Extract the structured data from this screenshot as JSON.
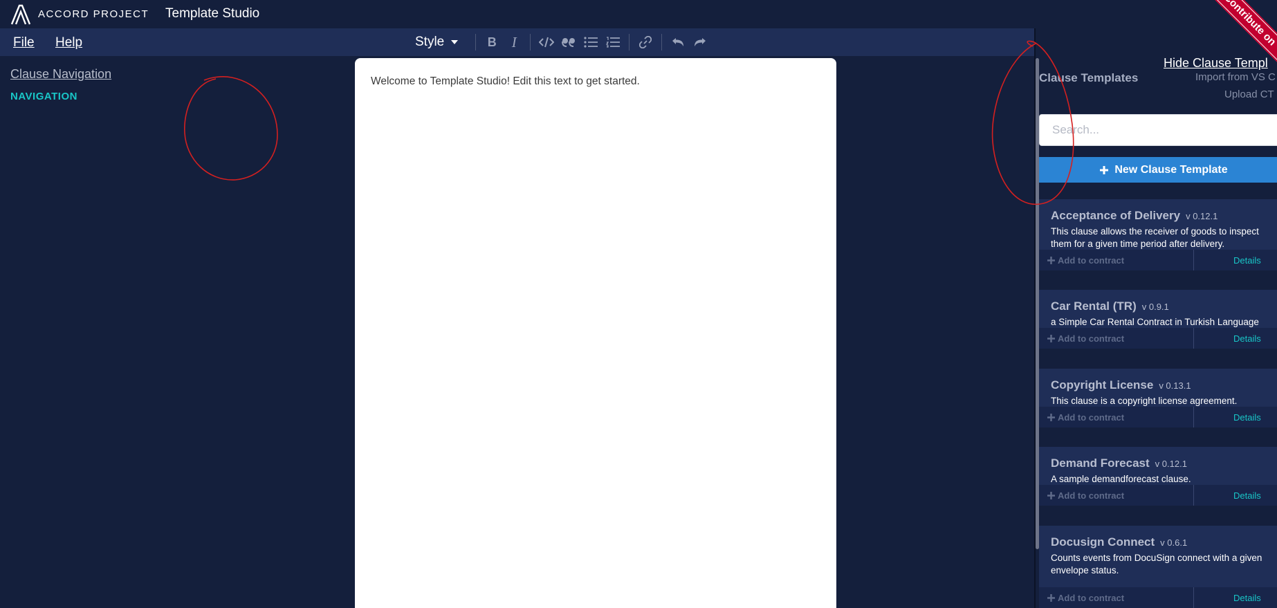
{
  "header": {
    "brand": "ACCORD PROJECT",
    "app_title": "Template Studio",
    "ribbon": "Contribute on"
  },
  "menu": {
    "file": "File",
    "help": "Help"
  },
  "toolbar": {
    "style_label": "Style",
    "buttons": [
      "bold-icon",
      "italic-icon",
      "code-icon",
      "quote-icon",
      "bulleted-list-icon",
      "numbered-list-icon",
      "link-icon",
      "undo-icon",
      "redo-icon"
    ]
  },
  "left_panel": {
    "clause_navigation": "Clause Navigation",
    "navigation_label": "NAVIGATION"
  },
  "editor": {
    "text": "Welcome to Template Studio! Edit this text to get started."
  },
  "right_panel": {
    "title": "Clause Templates",
    "hide_link": "Hide Clause Templ",
    "import_link": "Import from VS C",
    "upload_link": "Upload CT",
    "search_placeholder": "Search...",
    "new_button": "New Clause Template",
    "cards": [
      {
        "title": "Acceptance of Delivery",
        "version": "v 0.12.1",
        "description": "This clause allows the receiver of goods to inspect them for a given time period after delivery.",
        "add": "Add to contract",
        "details": "Details"
      },
      {
        "title": "Car Rental (TR)",
        "version": "v 0.9.1",
        "description": "a Simple Car Rental Contract in Turkish Language",
        "add": "Add to contract",
        "details": "Details"
      },
      {
        "title": "Copyright License",
        "version": "v 0.13.1",
        "description": "This clause is a copyright license agreement.",
        "add": "Add to contract",
        "details": "Details"
      },
      {
        "title": "Demand Forecast",
        "version": "v 0.12.1",
        "description": "A sample demandforecast clause.",
        "add": "Add to contract",
        "details": "Details"
      },
      {
        "title": "Docusign Connect",
        "version": "v 0.6.1",
        "description": "Counts events from DocuSign connect with a given envelope status.",
        "add": "Add to contract",
        "details": "Details"
      }
    ]
  },
  "colors": {
    "background": "#141F3C",
    "menubar": "#1F2E57",
    "accent_teal": "#19C6C7",
    "primary_button": "#2B84D4",
    "ribbon": "#C2002F",
    "annotation": "#D42020"
  }
}
